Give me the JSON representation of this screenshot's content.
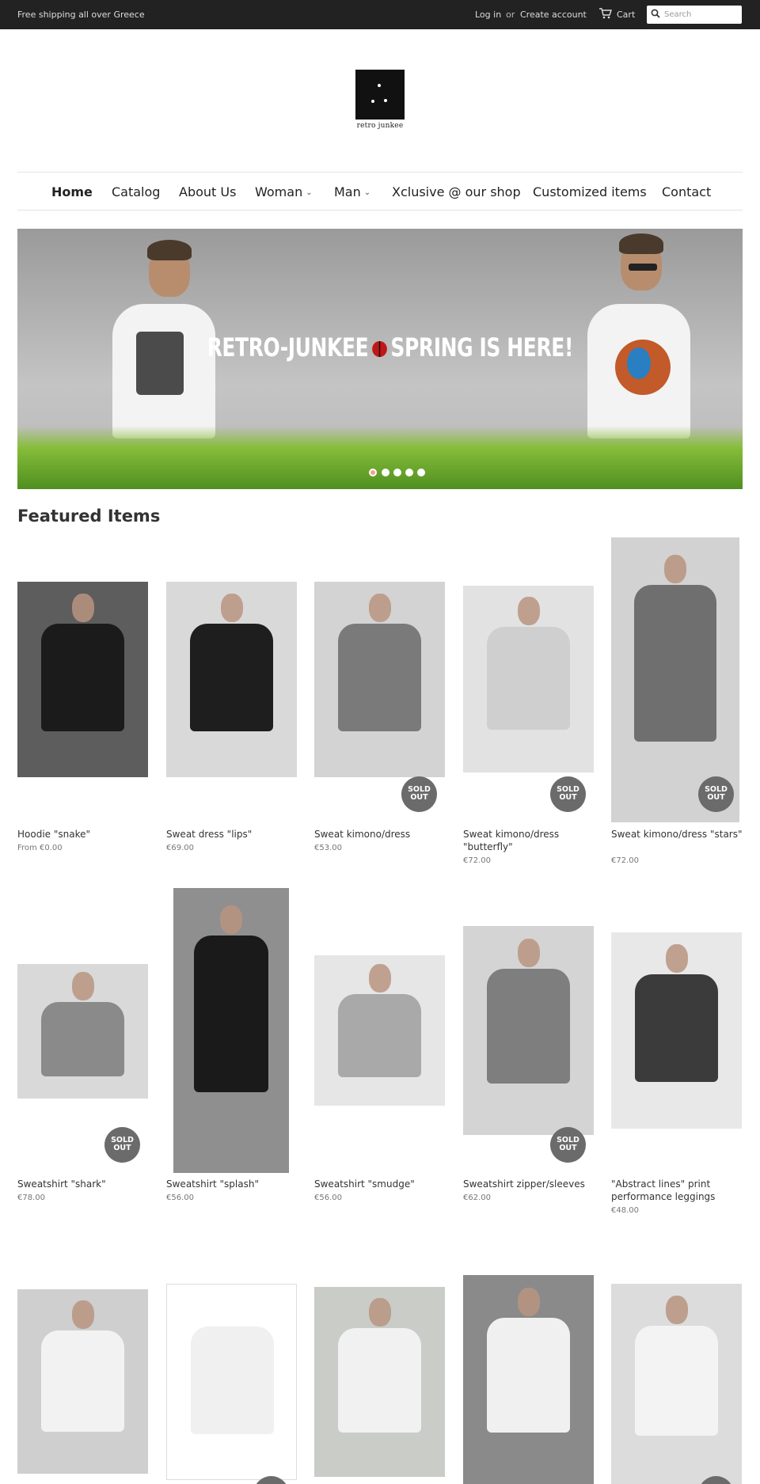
{
  "topbar": {
    "shipping": "Free shipping all over Greece",
    "login": "Log in",
    "or": "or",
    "create_account": "Create account",
    "cart": "Cart",
    "search_placeholder": "Search"
  },
  "logo": {
    "wordmark": "retro junkee"
  },
  "nav": {
    "items": [
      {
        "label": "Home"
      },
      {
        "label": "Catalog"
      },
      {
        "label": "About Us"
      },
      {
        "label": "Woman",
        "dropdown": true
      },
      {
        "label": "Man",
        "dropdown": true
      },
      {
        "label": "Xclusive @ our shop"
      },
      {
        "label": "Customized items"
      },
      {
        "label": "Contact"
      }
    ]
  },
  "hero": {
    "headline_left": "RETRO-JUNKEE",
    "headline_right": "SPRING IS HERE!",
    "slides": 5,
    "active_slide": 1
  },
  "featured": {
    "title": "Featured Items",
    "sold_out_label": [
      "SOLD",
      "OUT"
    ],
    "products": [
      {
        "name": "Hoodie \"snake\"",
        "price": "From €0.00",
        "sold_out": false
      },
      {
        "name": "Sweat dress \"lips\"",
        "price": "€69.00",
        "sold_out": false
      },
      {
        "name": "Sweat kimono/dress",
        "price": "€53.00",
        "sold_out": true
      },
      {
        "name": "Sweat kimono/dress \"butterfly\"",
        "price": "€72.00",
        "sold_out": true
      },
      {
        "name": "Sweat kimono/dress \"stars\"",
        "price": "€72.00",
        "sold_out": true
      },
      {
        "name": "Sweatshirt \"shark\"",
        "price": "€78.00",
        "sold_out": true
      },
      {
        "name": "Sweatshirt \"splash\"",
        "price": "€56.00",
        "sold_out": false
      },
      {
        "name": "Sweatshirt \"smudge\"",
        "price": "€56.00",
        "sold_out": false
      },
      {
        "name": "Sweatshirt zipper/sleeves",
        "price": "€62.00",
        "sold_out": true
      },
      {
        "name": "\"Abstract lines\" print performance leggings",
        "price": "€48.00",
        "sold_out": false
      },
      {
        "name": "",
        "price": "",
        "sold_out": false
      },
      {
        "name": "",
        "price": "",
        "sold_out": true
      },
      {
        "name": "",
        "price": "",
        "sold_out": false
      },
      {
        "name": "",
        "price": "",
        "sold_out": false
      },
      {
        "name": "",
        "price": "",
        "sold_out": true
      }
    ]
  }
}
